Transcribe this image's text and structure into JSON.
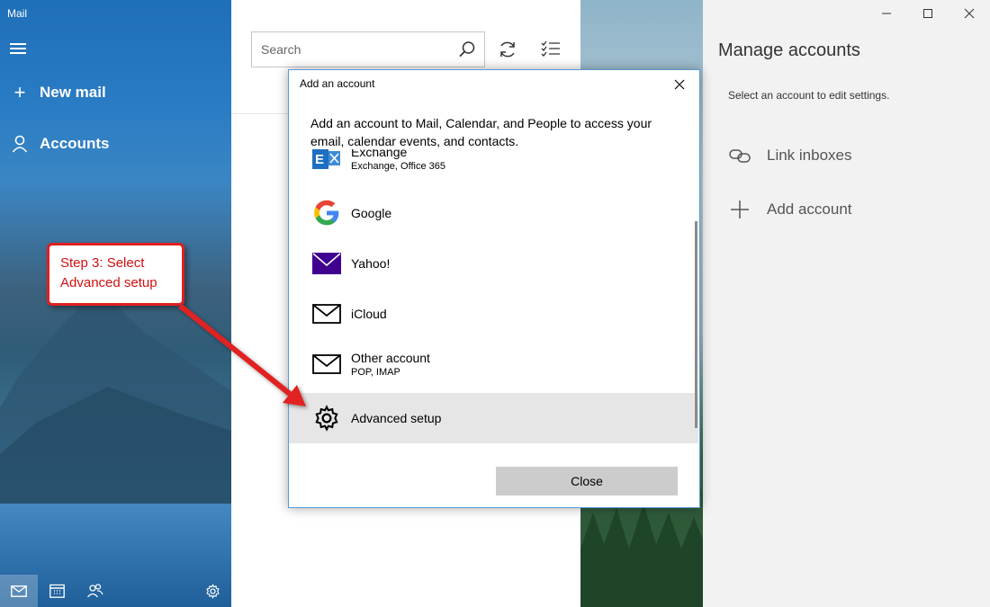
{
  "app": {
    "title": "Mail"
  },
  "nav": {
    "new_mail": "New mail",
    "accounts": "Accounts",
    "bottom_icons": [
      "mail-icon",
      "calendar-icon",
      "people-icon",
      "settings-icon"
    ]
  },
  "callout": {
    "line1": "Step 3: Select",
    "line2": "Advanced setup",
    "color": "#e02020"
  },
  "list": {
    "search_placeholder": "Search"
  },
  "manage": {
    "title": "Manage accounts",
    "subtitle": "Select an account to edit settings.",
    "link_inboxes": "Link inboxes",
    "add_account": "Add account"
  },
  "dialog": {
    "title": "Add an account",
    "intro": "Add an account to Mail, Calendar, and People to access your email, calendar events, and contacts.",
    "accounts": [
      {
        "name": "Exchange",
        "desc": "Exchange, Office 365",
        "icon": "exchange-icon"
      },
      {
        "name": "Google",
        "desc": "",
        "icon": "google-icon"
      },
      {
        "name": "Yahoo!",
        "desc": "",
        "icon": "yahoo-icon"
      },
      {
        "name": "iCloud",
        "desc": "",
        "icon": "envelope-icon"
      },
      {
        "name": "Other account",
        "desc": "POP, IMAP",
        "icon": "envelope-icon"
      },
      {
        "name": "Advanced setup",
        "desc": "",
        "icon": "gear-icon"
      }
    ],
    "selected": "Advanced setup",
    "close_label": "Close"
  },
  "colors": {
    "nav_blue": "#2a7cc4",
    "dialog_border": "#5a9bd5",
    "selected_row": "#e6e6e6",
    "yahoo_purple": "#400090",
    "exchange_blue": "#1e6fc0"
  }
}
